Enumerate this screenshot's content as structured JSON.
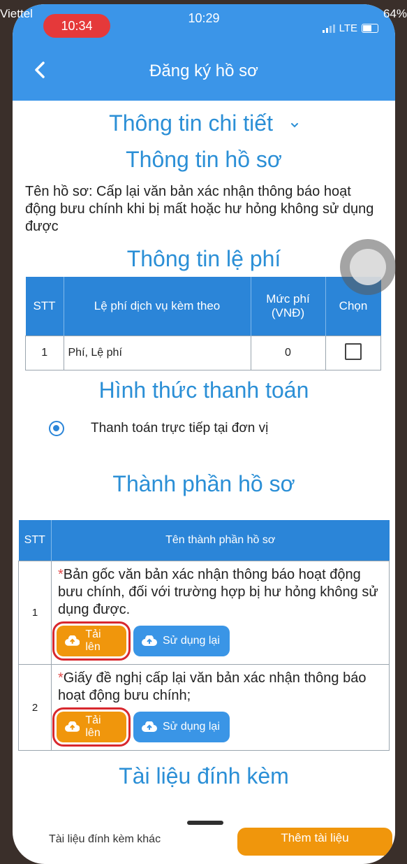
{
  "status_bar": {
    "carrier_left": "Viettel",
    "carrier_lte": "LTE",
    "time_pill": "10:34",
    "clock": "10:29",
    "network": "LTE",
    "battery_outer": "64%"
  },
  "navbar": {
    "title": "Đăng ký hồ sơ"
  },
  "detail_header": "Thông tin chi tiết",
  "profile_info": {
    "title": "Thông tin hồ sơ",
    "text": "Tên hồ sơ: Cấp lại văn bản xác nhận thông báo hoạt động bưu chính khi bị mất hoặc hư hỏng không sử dụng được"
  },
  "fee_info": {
    "title": "Thông tin lệ phí",
    "headers": [
      "STT",
      "Lệ phí dịch vụ kèm theo",
      "Mức phí (VNĐ)",
      "Chọn"
    ],
    "rows": [
      {
        "stt": "1",
        "name": "Phí, Lệ phí",
        "amount": "0"
      }
    ]
  },
  "payment": {
    "title": "Hình thức thanh toán",
    "option": "Thanh toán trực tiếp tại đơn vị"
  },
  "components": {
    "title": "Thành phần hồ sơ",
    "headers": [
      "STT",
      "Tên thành phần hồ sơ"
    ],
    "required_mark": "*",
    "rows": [
      {
        "stt": "1",
        "name": "Bản gốc văn bản xác nhận thông báo hoạt động bưu chính, đối với trường hợp bị hư hỏng không sử dụng được."
      },
      {
        "stt": "2",
        "name": "Giấy đề nghị cấp lại văn bản xác nhận thông báo hoạt động bưu chính;"
      }
    ],
    "upload_label": "Tải lên",
    "reuse_label": "Sử dụng lại"
  },
  "attachments": {
    "title": "Tài liệu đính kèm",
    "label": "Tài liệu đính kèm khác",
    "add_label": "Thêm tài liệu"
  },
  "colors": {
    "primary": "#3b95e8",
    "header_table": "#2b85d8",
    "title_text": "#2b8fd6",
    "upload_button": "#f0960c",
    "reuse_button": "#3a95e6",
    "highlight": "#d8282e"
  }
}
